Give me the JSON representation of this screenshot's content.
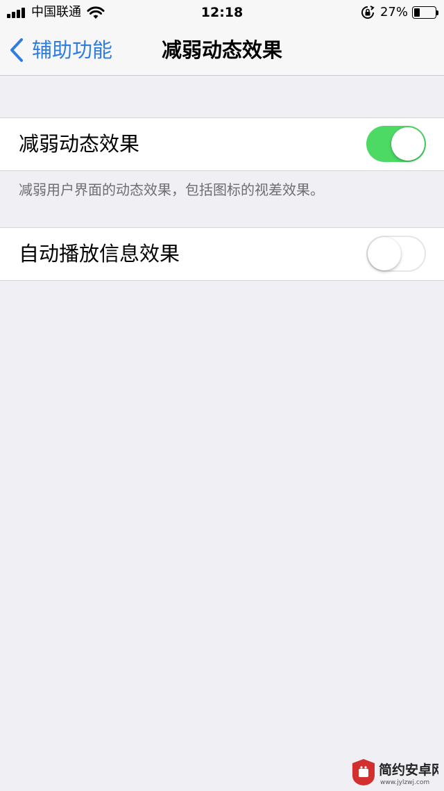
{
  "status_bar": {
    "carrier": "中国联通",
    "time": "12:18",
    "battery_percent": "27%",
    "battery_level": 0.27
  },
  "nav": {
    "back_label": "辅助功能",
    "title": "减弱动态效果"
  },
  "settings": {
    "reduce_motion": {
      "label": "减弱动态效果",
      "enabled": true,
      "footer": "减弱用户界面的动态效果，包括图标的视差效果。"
    },
    "auto_play_effects": {
      "label": "自动播放信息效果",
      "enabled": false
    }
  },
  "watermark": {
    "text": "简约安卓网",
    "url": "www.jylzwj.com"
  },
  "colors": {
    "accent": "#2f7de1",
    "switch_on": "#4cd964",
    "background": "#efeff4"
  }
}
